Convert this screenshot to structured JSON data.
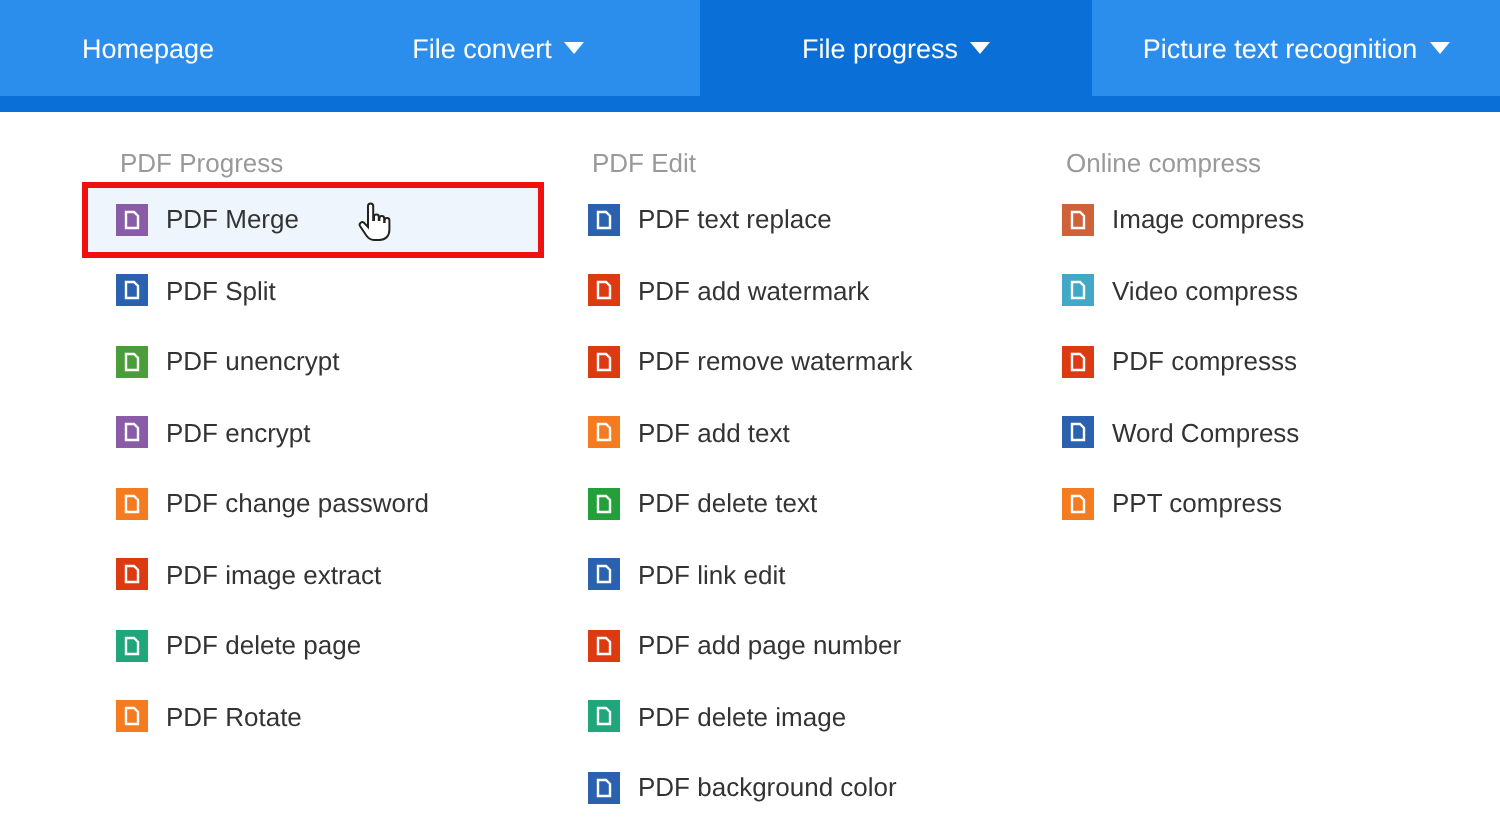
{
  "nav": [
    {
      "label": "Homepage",
      "selected": false,
      "dropdown": false
    },
    {
      "label": "File convert",
      "selected": false,
      "dropdown": true
    },
    {
      "label": "File progress",
      "selected": true,
      "dropdown": true
    },
    {
      "label": "Picture text recognition",
      "selected": false,
      "dropdown": true
    }
  ],
  "columns": [
    {
      "title": "PDF Progress",
      "items": [
        {
          "label": "PDF Merge",
          "color": "#8a5ca8",
          "selected": true
        },
        {
          "label": "PDF Split",
          "color": "#2a62b0",
          "selected": false
        },
        {
          "label": "PDF unencrypt",
          "color": "#4a9e3a",
          "selected": false
        },
        {
          "label": "PDF encrypt",
          "color": "#8a5ca8",
          "selected": false
        },
        {
          "label": "PDF change password",
          "color": "#f47b20",
          "selected": false
        },
        {
          "label": "PDF image extract",
          "color": "#dc3b12",
          "selected": false
        },
        {
          "label": "PDF delete page",
          "color": "#1fa67a",
          "selected": false
        },
        {
          "label": "PDF Rotate",
          "color": "#f47b20",
          "selected": false
        }
      ]
    },
    {
      "title": "PDF Edit",
      "items": [
        {
          "label": "PDF text replace",
          "color": "#2a62b0",
          "selected": false
        },
        {
          "label": "PDF add watermark",
          "color": "#dc3b12",
          "selected": false
        },
        {
          "label": "PDF remove watermark",
          "color": "#dc3b12",
          "selected": false
        },
        {
          "label": "PDF add text",
          "color": "#f47b20",
          "selected": false
        },
        {
          "label": "PDF delete text",
          "color": "#23a03a",
          "selected": false
        },
        {
          "label": "PDF link edit",
          "color": "#2a62b0",
          "selected": false
        },
        {
          "label": "PDF add page number",
          "color": "#dc3b12",
          "selected": false
        },
        {
          "label": "PDF delete image",
          "color": "#1fa67a",
          "selected": false
        },
        {
          "label": "PDF background color",
          "color": "#2a62b0",
          "selected": false
        }
      ]
    },
    {
      "title": "Online compress",
      "items": [
        {
          "label": "Image compress",
          "color": "#cf6238",
          "selected": false
        },
        {
          "label": "Video compress",
          "color": "#41a8c8",
          "selected": false
        },
        {
          "label": "PDF compresss",
          "color": "#dc3b12",
          "selected": false
        },
        {
          "label": "Word Compress",
          "color": "#2a62b0",
          "selected": false
        },
        {
          "label": "PPT compress",
          "color": "#f47b20",
          "selected": false
        }
      ]
    }
  ]
}
